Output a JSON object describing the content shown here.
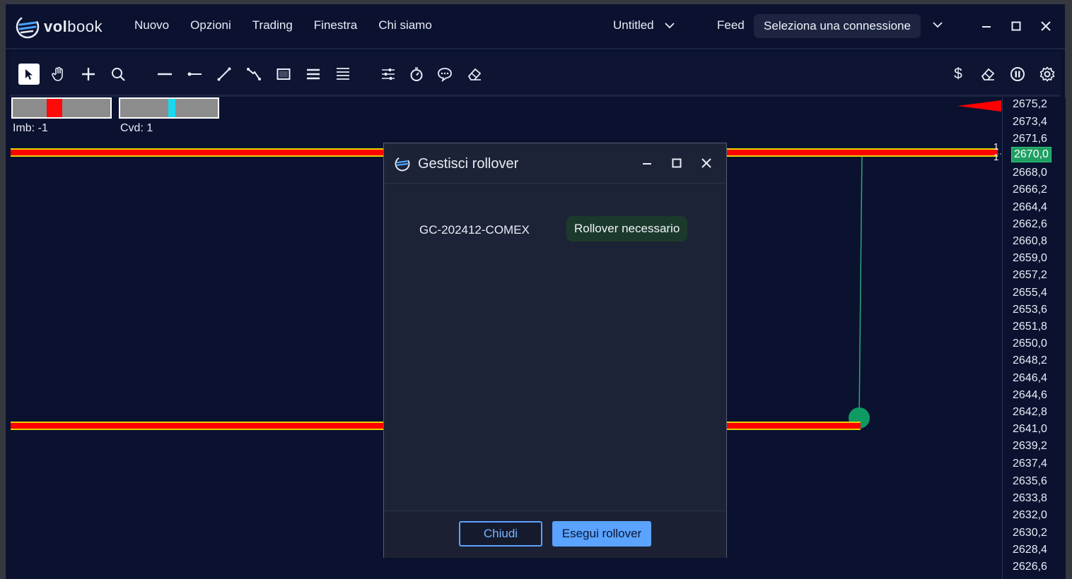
{
  "app": {
    "logo_prefix": "vol",
    "logo_suffix": "book"
  },
  "menu": {
    "items": [
      "Nuovo",
      "Opzioni",
      "Trading",
      "Finestra",
      "Chi siamo"
    ]
  },
  "workspace": {
    "name": "Untitled"
  },
  "feed": {
    "label": "Feed",
    "connection": "Seleziona una connessione"
  },
  "toolbar": {
    "tools": [
      "pointer-icon",
      "hand-icon",
      "crosshair-icon",
      "zoom-icon",
      "horizontal-line-icon",
      "ray-icon",
      "trend-line-icon",
      "path-icon",
      "rectangle-icon",
      "levels-icon",
      "fib-levels-icon",
      "settings-sliders-icon",
      "timer-icon",
      "comment-icon",
      "eraser-icon"
    ],
    "right_tools": [
      "dollar-icon",
      "eraser-icon",
      "pause-icon",
      "gear-icon"
    ],
    "dollar_symbol": "$"
  },
  "indicators": {
    "imbalance_label": "Imb: -1",
    "cvd_label": "Cvd: 1",
    "imbalance_value": -1,
    "cvd_value": 1
  },
  "price_axis": {
    "ticks": [
      "2675,2",
      "2673,4",
      "2671,6",
      "2670,0",
      "2668,0",
      "2666,2",
      "2664,4",
      "2662,6",
      "2660,8",
      "2659,0",
      "2657,2",
      "2655,4",
      "2653,6",
      "2651,8",
      "2650,0",
      "2648,2",
      "2646,4",
      "2644,6",
      "2642,8",
      "2641,0",
      "2639,2",
      "2637,4",
      "2635,6",
      "2633,8",
      "2632,0",
      "2630,2",
      "2628,4",
      "2626,6"
    ],
    "current_price": "2670,0",
    "marker_top": "1",
    "marker_bottom": "1",
    "line_color": "#ff0000",
    "line_border_color": "#e6d200",
    "order_color": "#1f9e63"
  },
  "dialog": {
    "title": "Gestisci rollover",
    "symbol": "GC-202412-COMEX",
    "status": "Rollover necessario",
    "close_label": "Chiudi",
    "execute_label": "Esegui rollover"
  }
}
